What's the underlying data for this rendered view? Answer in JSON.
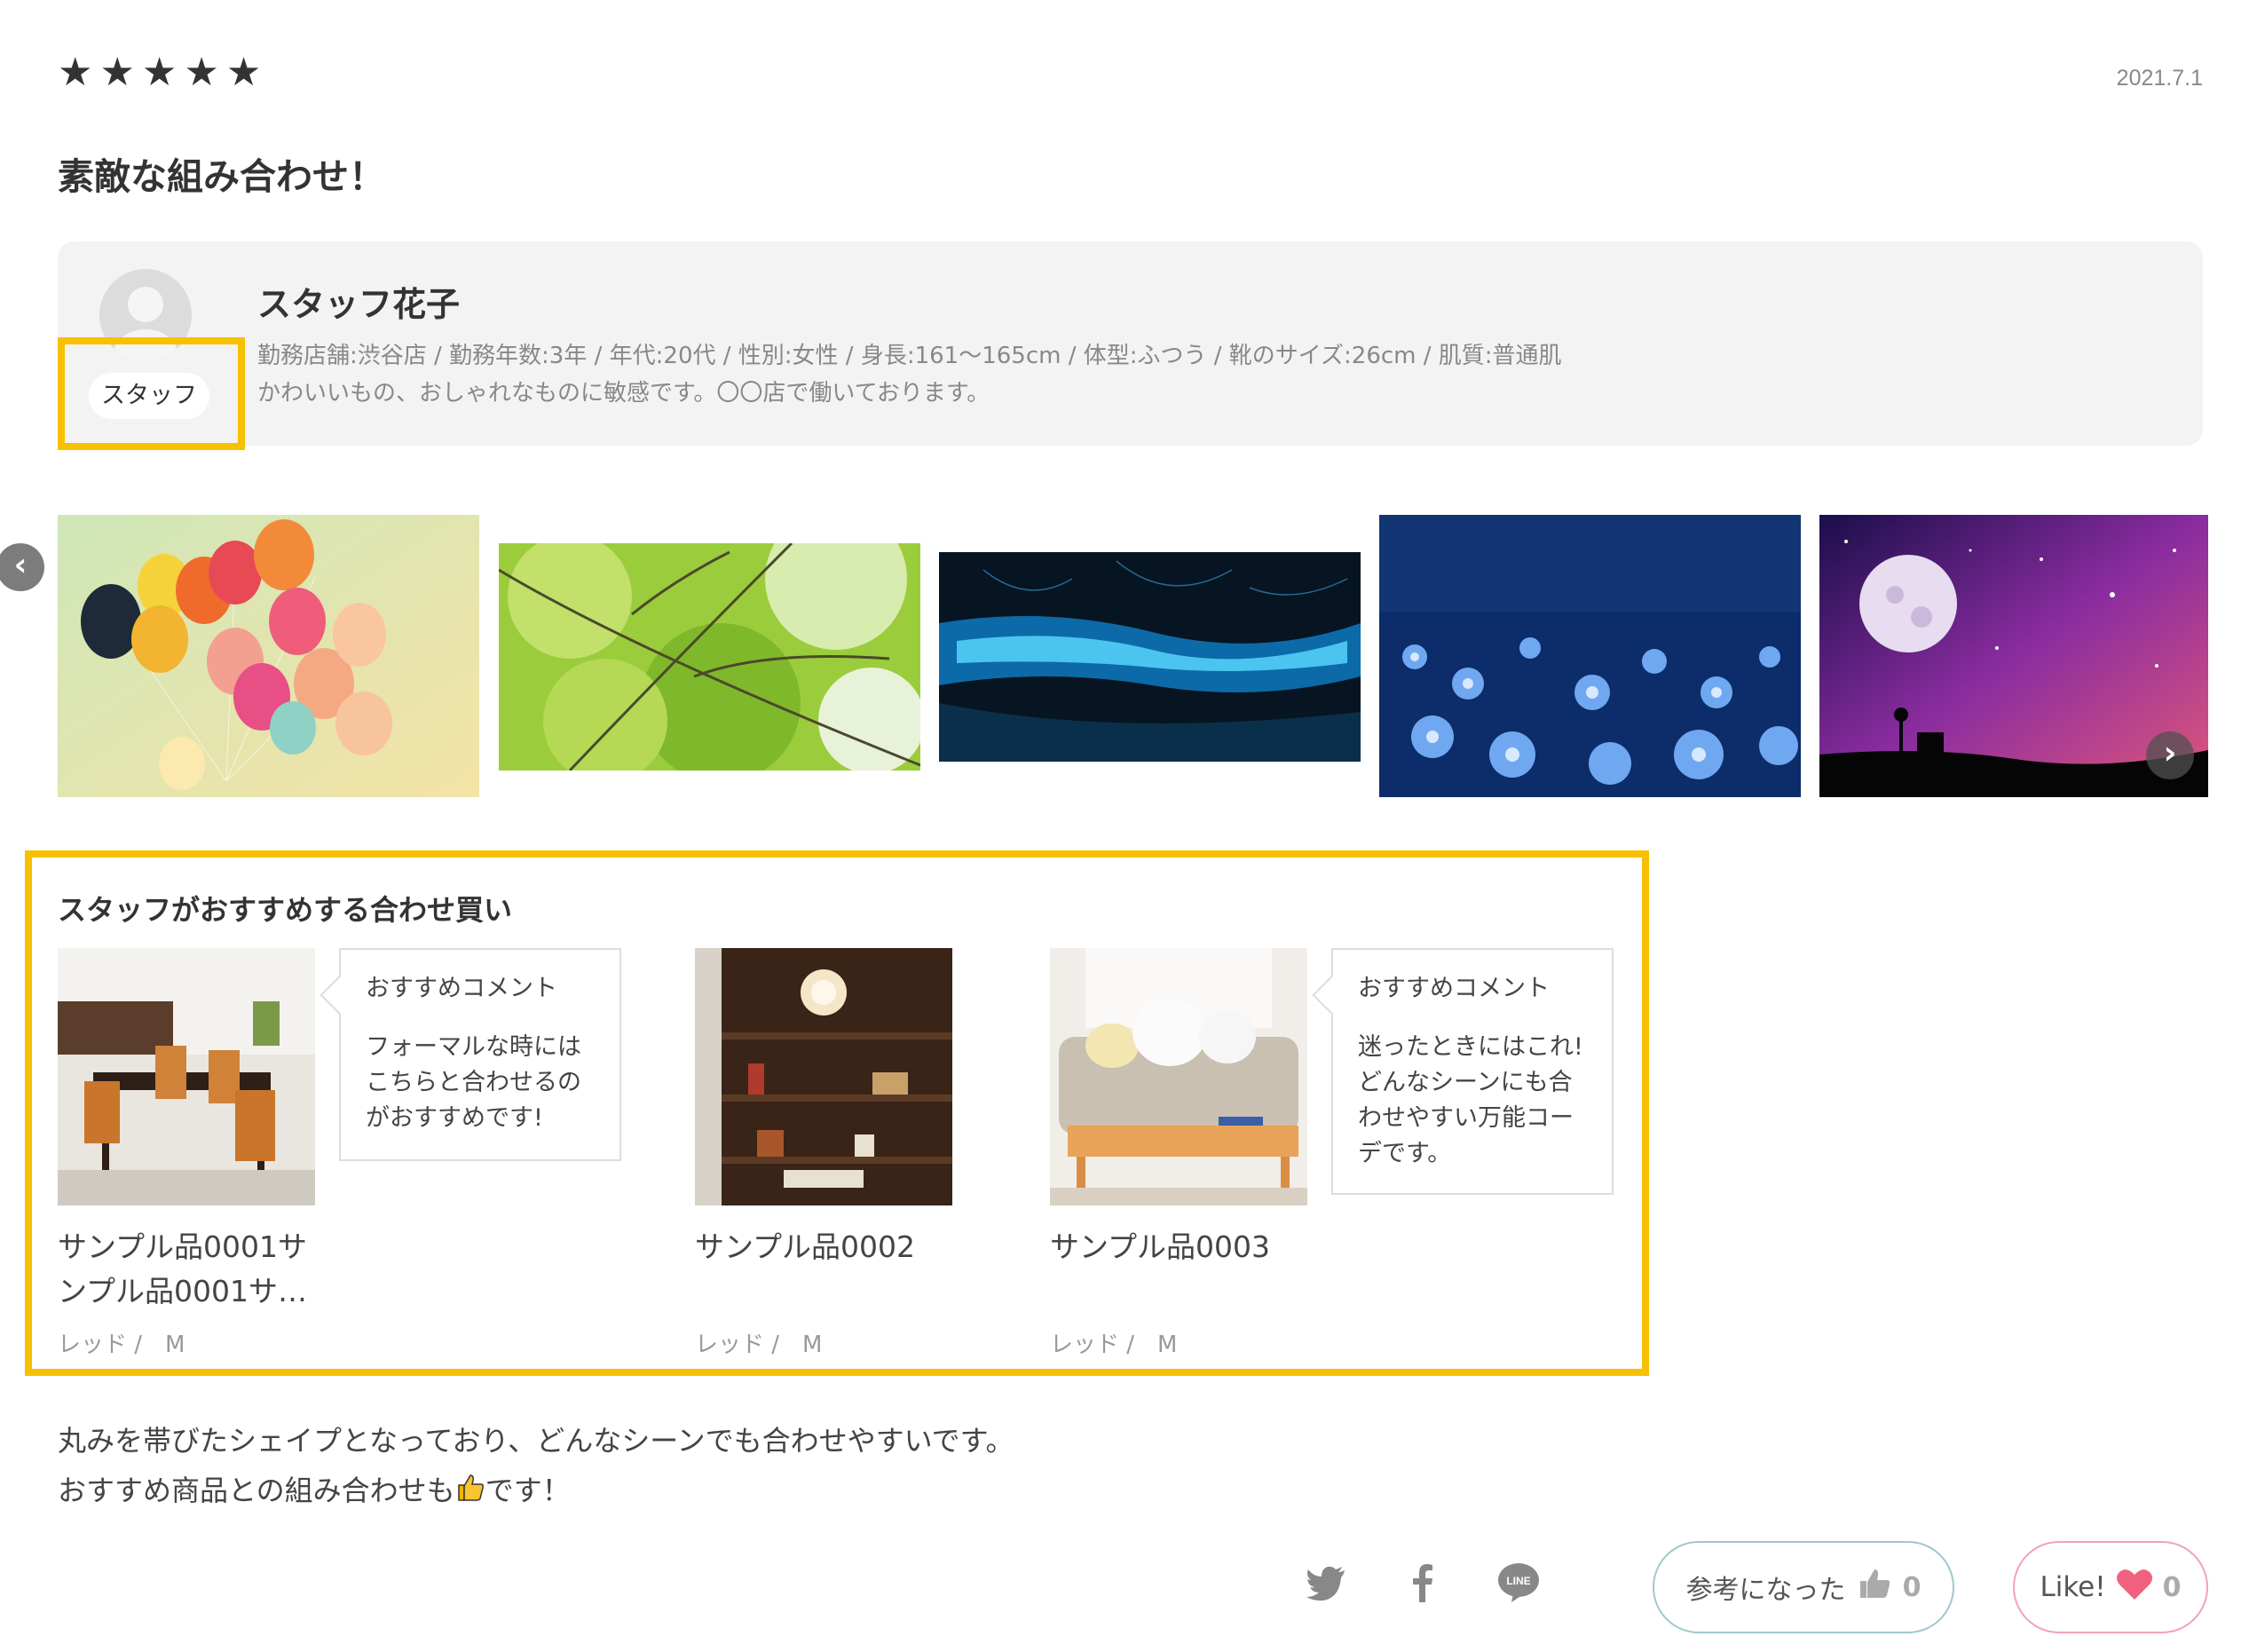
{
  "review": {
    "rating": 5,
    "stars": [
      "★",
      "★",
      "★",
      "★",
      "★"
    ],
    "date": "2021.7.1",
    "title": "素敵な組み合わせ！"
  },
  "staff": {
    "badge": "スタッフ",
    "name": "スタッフ花子",
    "meta": "勤務店舗:渋谷店 / 勤務年数:3年 / 年代:20代 / 性別:女性 / 身長:161～165cm / 体型:ふつう / 靴のサイズ:26cm / 肌質:普通肌",
    "description": "かわいいもの、おしゃれなものに敏感です。〇〇店で働いております。"
  },
  "gallery": {
    "images": [
      "balloons-photo",
      "green-leaves-photo",
      "blue-cave-photo",
      "blue-flowers-photo",
      "night-sky-moon-photo"
    ],
    "prev_icon": "‹",
    "next_icon": "›"
  },
  "recommendations": {
    "title": "スタッフがおすすめする合わせ買い",
    "items": [
      {
        "image": "dining-table-photo",
        "name": "サンプル品0001サンプル品0001サ…",
        "name_line1": "サンプル品0001サ",
        "name_line2": "ンプル品0001サ…",
        "variant": "レッド /　M",
        "comment_heading": "おすすめコメント",
        "comment": "フォーマルな時にはこちらと合わせるのがおすすめです!",
        "comment_lines": [
          "フォーマルな時には",
          "こちらと合わせるの",
          "がおすすめです!"
        ]
      },
      {
        "image": "shelf-photo",
        "name": "サンプル品0002",
        "variant": "レッド /　M"
      },
      {
        "image": "sofa-photo",
        "name": "サンプル品0003",
        "variant": "レッド /　M",
        "comment_heading": "おすすめコメント",
        "comment": "迷ったときにはこれ!どんなシーンにも合わせやすい万能コーデです。",
        "comment_lines": [
          "迷ったときにはこれ!",
          "どんなシーンにも合",
          "わせやすい万能コー",
          "デです。"
        ]
      }
    ]
  },
  "body": {
    "line1": "丸みを帯びたシェイプとなっており、どんなシーンでも合わせやすいです。",
    "line2_before": "おすすめ商品との組み合わせも",
    "line2_after": "です！"
  },
  "footer": {
    "social_icons": [
      "twitter-icon",
      "facebook-icon",
      "line-icon"
    ],
    "helpful_label": "参考になった",
    "helpful_count": "0",
    "like_label": "Like!",
    "like_count": "0",
    "colors": {
      "helpful_border": "#9fc8cc",
      "like_border": "#f2a3b3",
      "heart": "#f0607f",
      "highlight": "#f7c100"
    }
  }
}
